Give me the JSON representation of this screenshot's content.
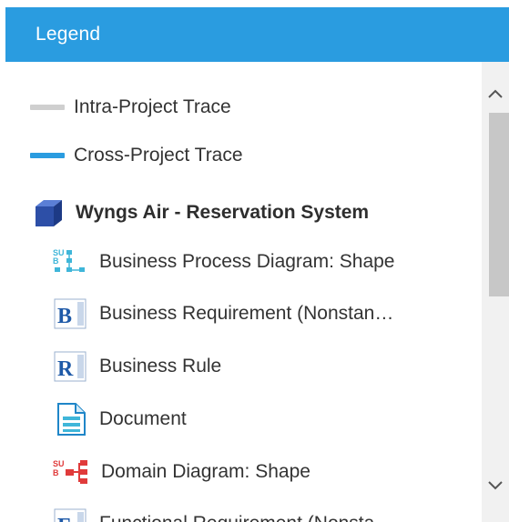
{
  "header": {
    "title": "Legend"
  },
  "legend": {
    "traces": [
      {
        "label": "Intra-Project Trace",
        "color": "#cfcfcf",
        "icon": "gray-line"
      },
      {
        "label": "Cross-Project Trace",
        "color": "#2a9ce0",
        "icon": "blue-line"
      }
    ],
    "project": {
      "label": "Wyngs Air - Reservation System",
      "icon": "project-cube-icon"
    },
    "items": [
      {
        "label": "Business Process Diagram: Shape",
        "icon": "business-process-diagram-icon"
      },
      {
        "label": "Business Requirement (Nonstan…",
        "icon": "business-requirement-icon"
      },
      {
        "label": "Business Rule",
        "icon": "business-rule-icon"
      },
      {
        "label": "Document",
        "icon": "document-icon"
      },
      {
        "label": "Domain Diagram: Shape",
        "icon": "domain-diagram-icon"
      },
      {
        "label": "Functional Requirement (Nonsta…",
        "icon": "functional-requirement-icon"
      }
    ]
  },
  "colors": {
    "header_bg": "#2a9ce0",
    "accent_blue": "#2a9ce0",
    "icon_blue": "#1f5aa8",
    "icon_red": "#e03b3b",
    "icon_cyan": "#3fb6d9"
  }
}
